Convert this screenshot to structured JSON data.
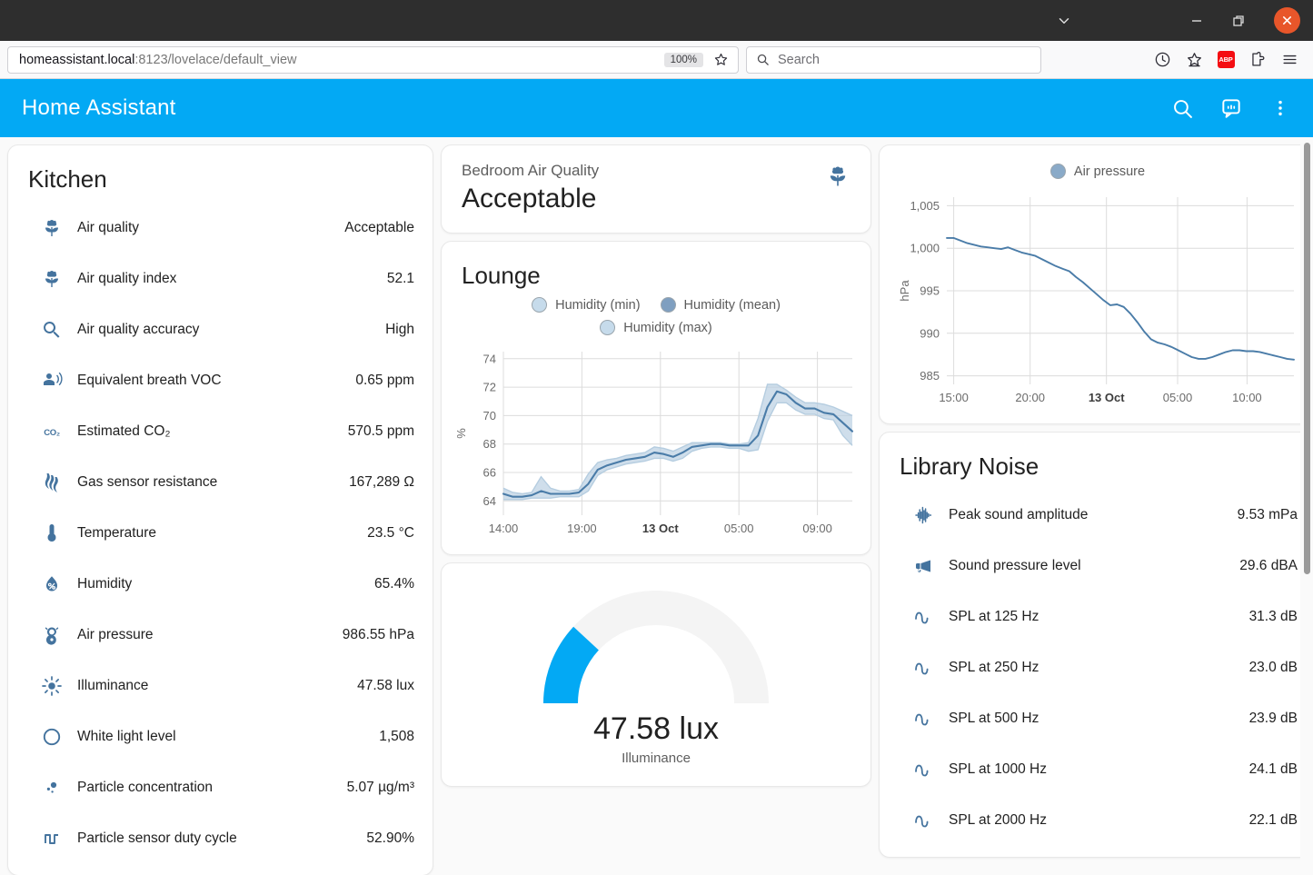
{
  "window": {
    "controls": [
      {
        "name": "chevron-down",
        "label": "⌄"
      },
      {
        "name": "minimize",
        "label": "—"
      },
      {
        "name": "restore",
        "label": "❐"
      },
      {
        "name": "close",
        "label": "✕"
      }
    ]
  },
  "browser": {
    "url_host": "homeassistant.local",
    "url_path": ":8123/lovelace/default_view",
    "zoom_level": "100%",
    "search_placeholder": "Search",
    "toolbar_icons": [
      "history-icon",
      "bookmarks-icon",
      "adblock-icon",
      "extensions-icon",
      "menu-icon"
    ],
    "adblock_label": "ABP"
  },
  "header": {
    "title": "Home Assistant",
    "icons": [
      "search-icon",
      "assist-icon",
      "overflow-menu-icon"
    ],
    "accent_color": "#03a9f4"
  },
  "kitchen": {
    "title": "Kitchen",
    "rows": [
      {
        "icon": "flower-tulip-icon",
        "name": "Air quality",
        "value": "Acceptable"
      },
      {
        "icon": "flower-tulip-icon",
        "name": "Air quality index",
        "value": "52.1"
      },
      {
        "icon": "magnify-icon",
        "name": "Air quality accuracy",
        "value": "High"
      },
      {
        "icon": "account-voice-icon",
        "name": "Equivalent breath VOC",
        "value": "0.65 ppm"
      },
      {
        "icon": "molecule-co2-icon",
        "name": "Estimated CO₂",
        "value": "570.5 ppm"
      },
      {
        "icon": "gas-icon",
        "name": "Gas sensor resistance",
        "value": "167,289 Ω"
      },
      {
        "icon": "thermometer-icon",
        "name": "Temperature",
        "value": "23.5 °C"
      },
      {
        "icon": "water-percent-icon",
        "name": "Humidity",
        "value": "65.4%"
      },
      {
        "icon": "gauge-pressure-icon",
        "name": "Air pressure",
        "value": "986.55 hPa"
      },
      {
        "icon": "brightness-icon",
        "name": "Illuminance",
        "value": "47.58 lux"
      },
      {
        "icon": "circle-outline-icon",
        "name": "White light level",
        "value": "1,508"
      },
      {
        "icon": "particles-icon",
        "name": "Particle concentration",
        "value": "5.07 µg/m³"
      },
      {
        "icon": "square-wave-icon",
        "name": "Particle sensor duty cycle",
        "value": "52.90%"
      }
    ]
  },
  "bedroom_air_quality": {
    "name": "Bedroom Air Quality",
    "state": "Acceptable",
    "icon": "flower-tulip-icon"
  },
  "lounge": {
    "title": "Lounge"
  },
  "library_noise": {
    "title": "Library Noise",
    "rows": [
      {
        "icon": "waveform-icon",
        "name": "Peak sound amplitude",
        "value": "9.53 mPa"
      },
      {
        "icon": "bullhorn-icon",
        "name": "Sound pressure level",
        "value": "29.6 dBA"
      },
      {
        "icon": "sine-wave-icon",
        "name": "SPL at 125 Hz",
        "value": "31.3 dB"
      },
      {
        "icon": "sine-wave-icon",
        "name": "SPL at 250 Hz",
        "value": "23.0 dB"
      },
      {
        "icon": "sine-wave-icon",
        "name": "SPL at 500 Hz",
        "value": "23.9 dB"
      },
      {
        "icon": "sine-wave-icon",
        "name": "SPL at 1000 Hz",
        "value": "24.1 dB"
      },
      {
        "icon": "sine-wave-icon",
        "name": "SPL at 2000 Hz",
        "value": "22.1 dB"
      }
    ]
  },
  "gauge": {
    "value": "47.58 lux",
    "label": "Illuminance",
    "fraction": 0.238,
    "color": "#03a9f4",
    "track_color": "#f4f4f4"
  },
  "chart_data": [
    {
      "type": "line",
      "id": "lounge-humidity",
      "title": "Lounge",
      "ylabel": "%",
      "xlabel": "",
      "ylim": [
        63,
        74.5
      ],
      "yticks": [
        64,
        66,
        68,
        70,
        72,
        74
      ],
      "xticks": [
        "14:00",
        "19:00",
        "13 Oct",
        "05:00",
        "09:00"
      ],
      "grid": true,
      "legend_position": "top",
      "legend": [
        "Humidity (min)",
        "Humidity (mean)",
        "Humidity (max)"
      ],
      "colors": {
        "mean": "#4a7ca8",
        "band": "#b5cde0"
      },
      "series": [
        {
          "name": "Humidity (mean)",
          "values": [
            64.5,
            64.3,
            64.3,
            64.4,
            64.7,
            64.5,
            64.5,
            64.5,
            64.6,
            65.2,
            66.2,
            66.5,
            66.7,
            66.9,
            67.0,
            67.1,
            67.4,
            67.3,
            67.1,
            67.4,
            67.8,
            67.9,
            68.0,
            68.0,
            67.9,
            67.9,
            67.9,
            68.6,
            70.6,
            71.7,
            71.5,
            70.9,
            70.5,
            70.5,
            70.2,
            70.1,
            69.5,
            68.9
          ]
        },
        {
          "name": "Humidity (min)",
          "values": [
            64.1,
            64.1,
            64.1,
            64.2,
            64.2,
            64.2,
            64.3,
            64.3,
            64.3,
            64.7,
            65.8,
            66.2,
            66.4,
            66.6,
            66.7,
            66.8,
            67.0,
            67.0,
            66.8,
            67.0,
            67.5,
            67.7,
            67.8,
            67.8,
            67.7,
            67.7,
            67.5,
            67.6,
            69.6,
            70.9,
            70.9,
            70.4,
            70.1,
            70.1,
            69.8,
            69.7,
            68.6,
            67.9
          ]
        },
        {
          "name": "Humidity (max)",
          "values": [
            64.9,
            64.6,
            64.5,
            64.6,
            65.7,
            64.9,
            64.7,
            64.7,
            64.8,
            65.9,
            66.7,
            66.9,
            67.0,
            67.2,
            67.3,
            67.4,
            67.8,
            67.7,
            67.5,
            67.8,
            68.1,
            68.1,
            68.1,
            68.1,
            68.0,
            68.0,
            68.1,
            69.8,
            72.2,
            72.2,
            71.8,
            71.3,
            70.9,
            70.9,
            70.8,
            70.6,
            70.3,
            70.0
          ]
        }
      ]
    },
    {
      "type": "line",
      "id": "air-pressure",
      "title": "",
      "ylabel": "hPa",
      "xlabel": "",
      "ylim": [
        984,
        1006
      ],
      "yticks": [
        985,
        990,
        995,
        1000,
        1005
      ],
      "xticks": [
        "15:00",
        "20:00",
        "13 Oct",
        "05:00",
        "10:00"
      ],
      "grid": true,
      "legend_position": "top",
      "legend": [
        "Air pressure"
      ],
      "colors": {
        "line": "#4a7ca8",
        "dot": "#8aaac8"
      },
      "series": [
        {
          "name": "Air pressure",
          "values": [
            1001.2,
            1001.2,
            1000.9,
            1000.6,
            1000.4,
            1000.2,
            1000.1,
            1000.0,
            999.9,
            1000.1,
            999.8,
            999.5,
            999.3,
            999.1,
            998.7,
            998.3,
            997.9,
            997.6,
            997.3,
            996.6,
            996.0,
            995.3,
            994.6,
            993.9,
            993.3,
            993.4,
            993.1,
            992.3,
            991.3,
            990.2,
            989.3,
            988.9,
            988.7,
            988.4,
            988.0,
            987.6,
            987.2,
            987.0,
            987.0,
            987.2,
            987.5,
            987.8,
            988.0,
            988.0,
            987.9,
            987.9,
            987.8,
            987.6,
            987.4,
            987.2,
            987.0,
            986.9
          ]
        }
      ]
    }
  ]
}
